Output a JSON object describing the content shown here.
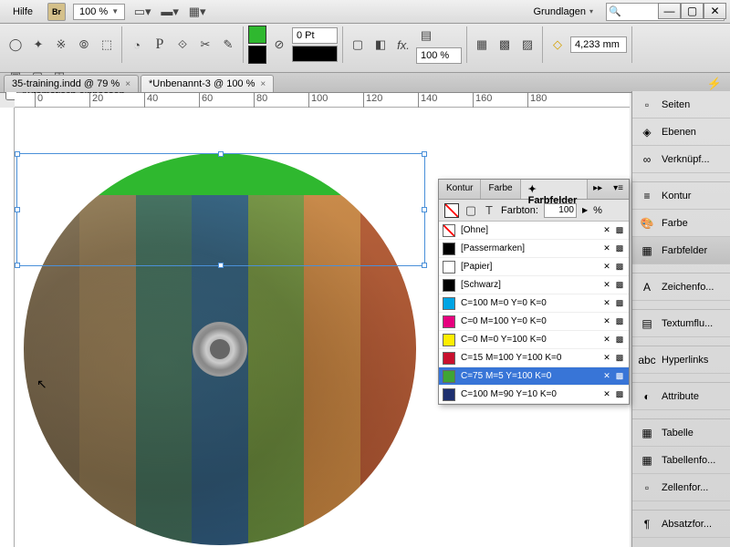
{
  "menu": {
    "help": "Hilfe",
    "bridge": "Br",
    "zoom": "100 %",
    "workspace": "Grundlagen"
  },
  "toolbar": {
    "stroke_weight": "0 Pt",
    "scale_pct": "100 %",
    "width_val": "4,233 mm",
    "autofit_label": "Automatisch einpassen"
  },
  "tabs": [
    {
      "label": "35-training.indd @ 79 %",
      "active": false
    },
    {
      "label": "*Unbenannt-3 @ 100 %",
      "active": true
    }
  ],
  "ruler_marks": [
    "0",
    "20",
    "40",
    "60",
    "80",
    "100",
    "120",
    "140",
    "160",
    "180"
  ],
  "swatches_panel": {
    "tabs": {
      "kontur": "Kontur",
      "farbe": "Farbe",
      "farbfelder": "Farbfelder"
    },
    "tint_label": "Farbton:",
    "tint_value": "100",
    "tint_suffix": "%",
    "items": [
      {
        "name": "[Ohne]",
        "color": "none"
      },
      {
        "name": "[Passermarken]",
        "color": "#000000"
      },
      {
        "name": "[Papier]",
        "color": "#ffffff"
      },
      {
        "name": "[Schwarz]",
        "color": "#000000"
      },
      {
        "name": "C=100 M=0 Y=0 K=0",
        "color": "#00a4e4"
      },
      {
        "name": "C=0 M=100 Y=0 K=0",
        "color": "#e6007e"
      },
      {
        "name": "C=0 M=0 Y=100 K=0",
        "color": "#ffed00"
      },
      {
        "name": "C=15 M=100 Y=100 K=0",
        "color": "#c8102e"
      },
      {
        "name": "C=75 M=5 Y=100 K=0",
        "color": "#3fa535",
        "selected": true
      },
      {
        "name": "C=100 M=90 Y=10 K=0",
        "color": "#1d2f6f"
      }
    ]
  },
  "right_panel": {
    "items": [
      {
        "label": "Seiten",
        "icon": "▫"
      },
      {
        "label": "Ebenen",
        "icon": "◈"
      },
      {
        "label": "Verknüpf...",
        "icon": "∞"
      },
      {
        "sep": true
      },
      {
        "label": "Kontur",
        "icon": "≡"
      },
      {
        "label": "Farbe",
        "icon": "🎨"
      },
      {
        "label": "Farbfelder",
        "icon": "▦",
        "active": true
      },
      {
        "sep": true
      },
      {
        "label": "Zeichenfo...",
        "icon": "A"
      },
      {
        "sep": true
      },
      {
        "label": "Textumflu...",
        "icon": "▤"
      },
      {
        "sep": true
      },
      {
        "label": "Hyperlinks",
        "icon": "abc"
      },
      {
        "sep": true
      },
      {
        "label": "Attribute",
        "icon": "◐"
      },
      {
        "sep": true
      },
      {
        "label": "Tabelle",
        "icon": "▦"
      },
      {
        "label": "Tabellenfo...",
        "icon": "▦"
      },
      {
        "label": "Zellenfor...",
        "icon": "▫"
      },
      {
        "sep": true
      },
      {
        "label": "Absatzfor...",
        "icon": "¶"
      }
    ]
  },
  "chart_data": null
}
